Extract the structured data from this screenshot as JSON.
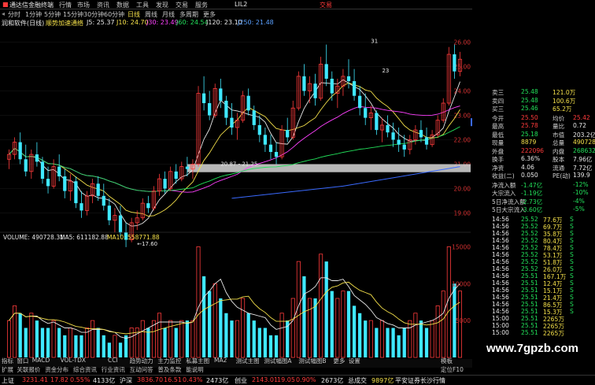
{
  "titlebar": {
    "app_title": "通达信金融终端",
    "menus": [
      "行情",
      "市场",
      "资讯",
      "数据",
      "工具",
      "发现",
      "交易",
      "服务"
    ],
    "code": "LIL2",
    "trade_label": "交易",
    "window_buttons": [
      "_",
      "□",
      "×"
    ]
  },
  "toolbar": {
    "periods": [
      "分时",
      "1分钟",
      "5分钟",
      "15分钟",
      "30分钟",
      "60分钟",
      "日线",
      "周线",
      "月线",
      "多周期",
      "更多"
    ],
    "active_period": "日线"
  },
  "infobar": {
    "stock": "润和软件(日线)",
    "indicator": "顺势加速通络",
    "ma": [
      {
        "label": "J5: 25.37",
        "color": "#e8e8e8"
      },
      {
        "label": "J10: 24.70",
        "color": "#f4e04a"
      },
      {
        "label": "J30: 23.49",
        "color": "#ff40ff"
      },
      {
        "label": "J60: 24.54",
        "color": "#22e05a"
      },
      {
        "label": "J120: 23.10",
        "color": "#e8e8e8"
      },
      {
        "label": "J250: 21.48",
        "color": "#5aa0ff"
      }
    ]
  },
  "chart_data": {
    "type": "candlestick",
    "price_axis": {
      "ticks": [
        26.0,
        25.0,
        24.0,
        23.0,
        22.0,
        21.0,
        20.0,
        19.0
      ],
      "range": [
        18.5,
        26.5
      ]
    },
    "current_price_tag": "22.72",
    "annotations": [
      {
        "text": "31",
        "x": 65,
        "price": 25.9
      },
      {
        "text": "23",
        "x": 67,
        "price": 24.7
      },
      {
        "text": "←17.60",
        "x": 23,
        "price": 17.6
      },
      {
        "text": "20.87 - 21.25",
        "x": 38,
        "price": 20.87
      }
    ],
    "candles": [
      [
        21.2,
        21.6,
        20.8,
        21.4
      ],
      [
        21.4,
        22.1,
        21.2,
        21.9
      ],
      [
        21.9,
        22.3,
        21.0,
        21.2
      ],
      [
        21.2,
        21.8,
        20.5,
        20.7
      ],
      [
        20.7,
        21.6,
        20.4,
        21.4
      ],
      [
        21.4,
        21.9,
        20.9,
        21.1
      ],
      [
        21.1,
        21.3,
        20.2,
        20.4
      ],
      [
        20.4,
        20.9,
        19.8,
        20.1
      ],
      [
        20.1,
        21.2,
        20.0,
        20.9
      ],
      [
        20.9,
        21.4,
        20.3,
        20.5
      ],
      [
        20.5,
        20.8,
        19.6,
        19.9
      ],
      [
        19.9,
        20.6,
        19.5,
        20.3
      ],
      [
        20.3,
        20.5,
        19.2,
        19.4
      ],
      [
        19.4,
        19.9,
        18.8,
        19.1
      ],
      [
        19.1,
        19.9,
        18.9,
        19.7
      ],
      [
        19.7,
        20.4,
        19.4,
        20.2
      ],
      [
        20.2,
        20.5,
        19.5,
        19.7
      ],
      [
        19.7,
        20.2,
        19.1,
        19.3
      ],
      [
        19.3,
        19.6,
        18.5,
        18.7
      ],
      [
        18.7,
        19.2,
        18.2,
        18.9
      ],
      [
        18.9,
        19.3,
        18.0,
        18.2
      ],
      [
        18.2,
        18.6,
        17.6,
        17.9
      ],
      [
        17.9,
        18.8,
        17.8,
        18.6
      ],
      [
        18.6,
        19.1,
        18.3,
        18.8
      ],
      [
        18.8,
        19.6,
        18.7,
        19.4
      ],
      [
        19.4,
        19.7,
        19.0,
        19.2
      ],
      [
        19.2,
        20.1,
        19.1,
        19.9
      ],
      [
        19.9,
        20.6,
        19.7,
        20.4
      ],
      [
        20.4,
        20.7,
        19.8,
        20.0
      ],
      [
        20.0,
        20.9,
        19.9,
        20.7
      ],
      [
        20.7,
        21.0,
        20.2,
        20.4
      ],
      [
        20.4,
        21.1,
        20.3,
        20.9
      ],
      [
        20.9,
        21.3,
        20.5,
        20.8
      ],
      [
        20.8,
        21.2,
        20.4,
        21.0
      ],
      [
        21.0,
        24.2,
        20.9,
        23.9
      ],
      [
        23.9,
        24.6,
        23.2,
        23.5
      ],
      [
        23.5,
        24.0,
        22.8,
        23.0
      ],
      [
        23.0,
        24.3,
        22.9,
        24.1
      ],
      [
        24.1,
        24.5,
        23.3,
        23.6
      ],
      [
        23.6,
        23.8,
        22.6,
        22.9
      ],
      [
        22.9,
        23.5,
        22.2,
        22.5
      ],
      [
        22.5,
        23.1,
        22.0,
        22.8
      ],
      [
        22.8,
        24.0,
        22.7,
        23.8
      ],
      [
        23.8,
        24.1,
        23.0,
        23.2
      ],
      [
        23.2,
        23.4,
        22.4,
        22.6
      ],
      [
        22.6,
        23.0,
        21.9,
        22.2
      ],
      [
        22.2,
        22.5,
        21.5,
        21.8
      ],
      [
        21.8,
        22.2,
        21.2,
        21.5
      ],
      [
        21.5,
        21.9,
        21.0,
        21.3
      ],
      [
        21.3,
        22.6,
        21.2,
        22.4
      ],
      [
        22.4,
        22.9,
        21.9,
        22.1
      ],
      [
        22.1,
        23.6,
        22.0,
        23.3
      ],
      [
        23.3,
        24.8,
        23.2,
        24.6
      ],
      [
        24.6,
        25.1,
        23.8,
        24.0
      ],
      [
        24.0,
        24.6,
        23.5,
        24.3
      ],
      [
        24.3,
        24.7,
        23.4,
        23.7
      ],
      [
        23.7,
        25.4,
        23.6,
        25.1
      ],
      [
        25.1,
        25.9,
        24.2,
        24.5
      ],
      [
        24.5,
        24.8,
        23.6,
        23.9
      ],
      [
        23.9,
        24.5,
        23.3,
        24.2
      ],
      [
        24.2,
        24.9,
        23.8,
        24.6
      ],
      [
        24.6,
        25.3,
        24.1,
        24.4
      ],
      [
        24.4,
        24.9,
        23.6,
        23.8
      ],
      [
        23.8,
        24.2,
        23.0,
        23.3
      ],
      [
        23.3,
        23.9,
        22.6,
        22.9
      ],
      [
        22.9,
        23.4,
        22.4,
        23.1
      ],
      [
        23.1,
        23.2,
        22.2,
        22.4
      ],
      [
        22.4,
        22.9,
        21.9,
        22.6
      ],
      [
        22.6,
        23.0,
        22.1,
        22.3
      ],
      [
        22.3,
        22.7,
        21.7,
        22.0
      ],
      [
        22.0,
        22.5,
        21.5,
        21.8
      ],
      [
        21.8,
        22.2,
        21.3,
        21.6
      ],
      [
        21.6,
        22.2,
        21.4,
        22.0
      ],
      [
        22.0,
        22.6,
        21.8,
        22.4
      ],
      [
        22.4,
        22.8,
        21.9,
        22.1
      ],
      [
        22.1,
        22.5,
        21.6,
        21.8
      ],
      [
        21.8,
        22.4,
        21.7,
        22.2
      ],
      [
        22.2,
        23.0,
        22.1,
        22.8
      ],
      [
        22.8,
        23.7,
        22.7,
        23.5
      ],
      [
        23.5,
        25.8,
        23.4,
        25.5
      ],
      [
        25.5,
        25.9,
        24.5,
        24.8
      ],
      [
        24.8,
        25.6,
        24.6,
        25.3
      ]
    ],
    "volume_panel": {
      "label": "VOLUME: 490728.31",
      "ma5": "MA5: 611182.88",
      "ma10": "MA10: 558771.88",
      "axis_ticks": [
        "15000",
        "10000",
        "5000"
      ],
      "values": [
        5,
        7,
        6,
        4,
        6,
        5,
        4,
        4,
        5,
        4,
        3,
        4,
        3,
        3,
        4,
        5,
        4,
        3,
        2,
        3,
        2,
        3,
        4,
        4,
        5,
        4,
        5,
        6,
        4,
        5,
        4,
        5,
        5,
        5,
        15,
        11,
        9,
        10,
        8,
        6,
        5,
        5,
        8,
        6,
        5,
        4,
        4,
        3,
        3,
        6,
        5,
        8,
        13,
        11,
        8,
        8,
        14,
        13,
        9,
        8,
        9,
        9,
        7,
        6,
        5,
        5,
        4,
        5,
        4,
        4,
        3,
        4,
        5,
        6,
        5,
        4,
        5,
        7,
        9,
        15,
        10,
        9
      ],
      "x_labels": [
        "2022年",
        "12",
        "2023/01/16/一",
        "2",
        "3",
        "4",
        "5"
      ]
    }
  },
  "rightpanel": {
    "rows": [
      {
        "label": "卖三",
        "v1": "25.48",
        "v2": "121.0万",
        "c1": "#22e05a",
        "c2": "#f4e04a"
      },
      {
        "label": "卖四",
        "v1": "25.48",
        "v2": "100.6万",
        "c1": "#22e05a",
        "c2": "#f4e04a"
      },
      {
        "label": "买三",
        "v1": "25.46",
        "v2": "65.2万",
        "c1": "#22e05a",
        "c2": "#f4e04a"
      },
      {
        "label": "今开",
        "v1": "25.50",
        "v2": "均价",
        "v3": "25.42",
        "c1": "#ff3b3b",
        "c3": "#ff3b3b"
      },
      {
        "label": "最高",
        "v1": "25.78",
        "v2": "量比",
        "v3": "0.72",
        "c1": "#ff3b3b",
        "c3": "#e8e8e8"
      },
      {
        "label": "最低",
        "v1": "25.18",
        "v2": "市值",
        "v3": "203.2亿",
        "c1": "#22e05a",
        "c3": "#e8e8e8"
      },
      {
        "label": "现量",
        "v1": "8879",
        "v2": "总量",
        "v3": "490728",
        "c1": "#f4e04a",
        "c3": "#f4e04a"
      },
      {
        "label": "外盘",
        "v1": "222096",
        "v2": "内盘",
        "v3": "268632",
        "c1": "#ff3b3b",
        "c3": "#22e05a"
      },
      {
        "label": "换手",
        "v1": "6.36%",
        "v2": "股本",
        "v3": "7.96亿",
        "c1": "#e8e8e8",
        "c3": "#e8e8e8"
      },
      {
        "label": "净资",
        "v1": "4.06",
        "v2": "流通",
        "v3": "7.72亿",
        "c1": "#e8e8e8",
        "c3": "#e8e8e8"
      },
      {
        "label": "收益(二)",
        "v1": "0.050",
        "v2": "PE(动)",
        "v3": "139.9",
        "c1": "#e8e8e8",
        "c3": "#e8e8e8"
      },
      {
        "label": "净流入额",
        "v1": "-1.47亿",
        "v3": "-12%",
        "c1": "#22e05a",
        "c3": "#22e05a"
      },
      {
        "label": "大宗流入",
        "v1": "-1.19亿",
        "v3": "-10%",
        "c1": "#22e05a",
        "c3": "#22e05a"
      },
      {
        "label": "5日净流入额",
        "v1": "-2.73亿",
        "v3": "-4%",
        "c1": "#22e05a",
        "c3": "#22e05a"
      },
      {
        "label": "5日大宗流入",
        "v1": "-3.60亿",
        "v3": "-5%",
        "c1": "#22e05a",
        "c3": "#22e05a"
      }
    ],
    "trades": [
      {
        "t": "14:56",
        "p": "25.52",
        "v": "77.6万",
        "s": "S"
      },
      {
        "t": "14:56",
        "p": "25.52",
        "v": "69.7万",
        "s": "S"
      },
      {
        "t": "14:56",
        "p": "25.52",
        "v": "35.8万",
        "s": "S"
      },
      {
        "t": "14:56",
        "p": "25.52",
        "v": "80.4万",
        "s": "S"
      },
      {
        "t": "14:56",
        "p": "25.52",
        "v": "78.4万",
        "s": "S"
      },
      {
        "t": "14:56",
        "p": "25.52",
        "v": "53.1万",
        "s": "S"
      },
      {
        "t": "14:56",
        "p": "25.52",
        "v": "51.8万",
        "s": "S"
      },
      {
        "t": "14:56",
        "p": "25.52",
        "v": "26.0万",
        "s": "S"
      },
      {
        "t": "14:56",
        "p": "25.51",
        "v": "167.1万",
        "s": "S"
      },
      {
        "t": "14:56",
        "p": "25.51",
        "v": "12.4万",
        "s": "S"
      },
      {
        "t": "14:56",
        "p": "25.51",
        "v": "15.1万",
        "s": "S"
      },
      {
        "t": "14:56",
        "p": "25.51",
        "v": "21.4万",
        "s": "S"
      },
      {
        "t": "14:56",
        "p": "25.51",
        "v": "86.5万",
        "s": "S"
      },
      {
        "t": "14:56",
        "p": "25.51",
        "v": "15.3万",
        "s": "S"
      },
      {
        "t": "15:00",
        "p": "25.51",
        "v": "2265万",
        "s": ""
      },
      {
        "t": "15:00",
        "p": "25.51",
        "v": "2265万",
        "s": ""
      },
      {
        "t": "15:00",
        "p": "25.51",
        "v": "2265万",
        "s": ""
      }
    ]
  },
  "bottomtabs": {
    "row1": [
      "指标",
      "窗口",
      "MACD",
      "VOL-TDX",
      "CCI",
      "趋势动力",
      "主力监控",
      "私募主图",
      "MA2",
      "测试主图",
      "测试幅图A",
      "测试幅图B",
      "更多",
      "设置"
    ],
    "row2": [
      "扩展",
      "关联报价",
      "资金分布",
      "综合资讯",
      "行业资讯",
      "互动问答",
      "普及条款",
      "能说明"
    ],
    "right": [
      "模板",
      "定位F10"
    ]
  },
  "statusbar": {
    "items": [
      {
        "label": "上证",
        "value": "3231.41",
        "chg": "17.82",
        "pct": "0.55%",
        "amt": "4133亿"
      },
      {
        "label": "沪深",
        "value": "3836.70",
        "chg": "16.51",
        "pct": "0.43%",
        "amt": "2473亿"
      },
      {
        "label": "创业",
        "value": "2143.01",
        "chg": "19.05",
        "pct": "0.90%",
        "amt": "2673亿"
      }
    ],
    "total_label": "总成交",
    "total_value": "9897亿",
    "broker": "平安证券长沙行情"
  },
  "watermark": "www.7gpzb.com"
}
